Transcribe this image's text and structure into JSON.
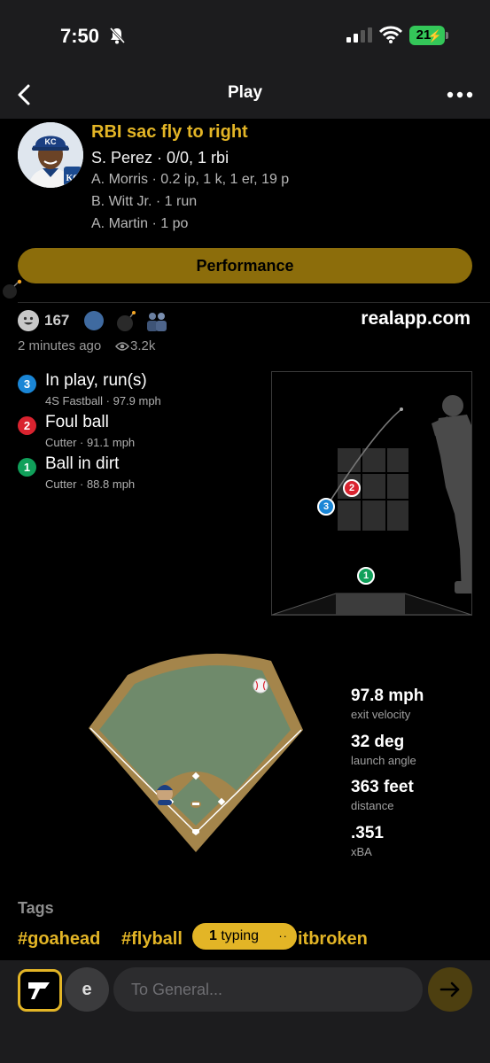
{
  "status_bar": {
    "time": "7:50",
    "battery": "21",
    "icons": [
      "bell-slash-icon",
      "signal-icon",
      "wifi-icon",
      "battery-charging-icon"
    ]
  },
  "nav": {
    "title": "Play",
    "back_icon": "chevron-left-icon",
    "more_icon": "ellipsis-icon"
  },
  "play": {
    "title": "RBI sac fly to right",
    "batter": "S. Perez · 0/0, 1 rbi",
    "lines": [
      "A. Morris · 0.2 ip, 1 k, 1 er, 19 p",
      "B. Witt Jr. · 1 run",
      "A. Martin · 1 po"
    ],
    "team_logo_text": "KC"
  },
  "performance_button": "Performance",
  "social": {
    "reaction_count": "167",
    "source": "realapp.com",
    "time_ago": "2 minutes ago",
    "views": "3.2k"
  },
  "pitches": [
    {
      "number": "3",
      "result": "In play, run(s)",
      "detail": "4S Fastball ·  97.9 mph",
      "color": "#1a86d6"
    },
    {
      "number": "2",
      "result": "Foul ball",
      "detail": "Cutter ·  91.1 mph",
      "color": "#d9232f"
    },
    {
      "number": "1",
      "result": "Ball in dirt",
      "detail": "Cutter ·  88.8 mph",
      "color": "#10a05a"
    }
  ],
  "hit_stats": [
    {
      "value": "97.8 mph",
      "label": "exit velocity"
    },
    {
      "value": "32 deg",
      "label": "launch angle"
    },
    {
      "value": "363 feet",
      "label": "distance"
    },
    {
      "value": ".351",
      "label": "xBA"
    }
  ],
  "tags": {
    "title": "Tags",
    "items": [
      "#goahead",
      "#flyball",
      "#tiebroken"
    ],
    "visible_items": [
      "#goahead",
      "#flyball",
      "itbroken"
    ]
  },
  "typing": {
    "count": "1",
    "text": "typing"
  },
  "composer": {
    "placeholder": "To General...",
    "user_initial": "e"
  },
  "colors": {
    "accent": "#e3b526",
    "performance_button": "#8c6d0b",
    "infield_dirt": "#a4854b",
    "grass": "#6f8a6b"
  }
}
